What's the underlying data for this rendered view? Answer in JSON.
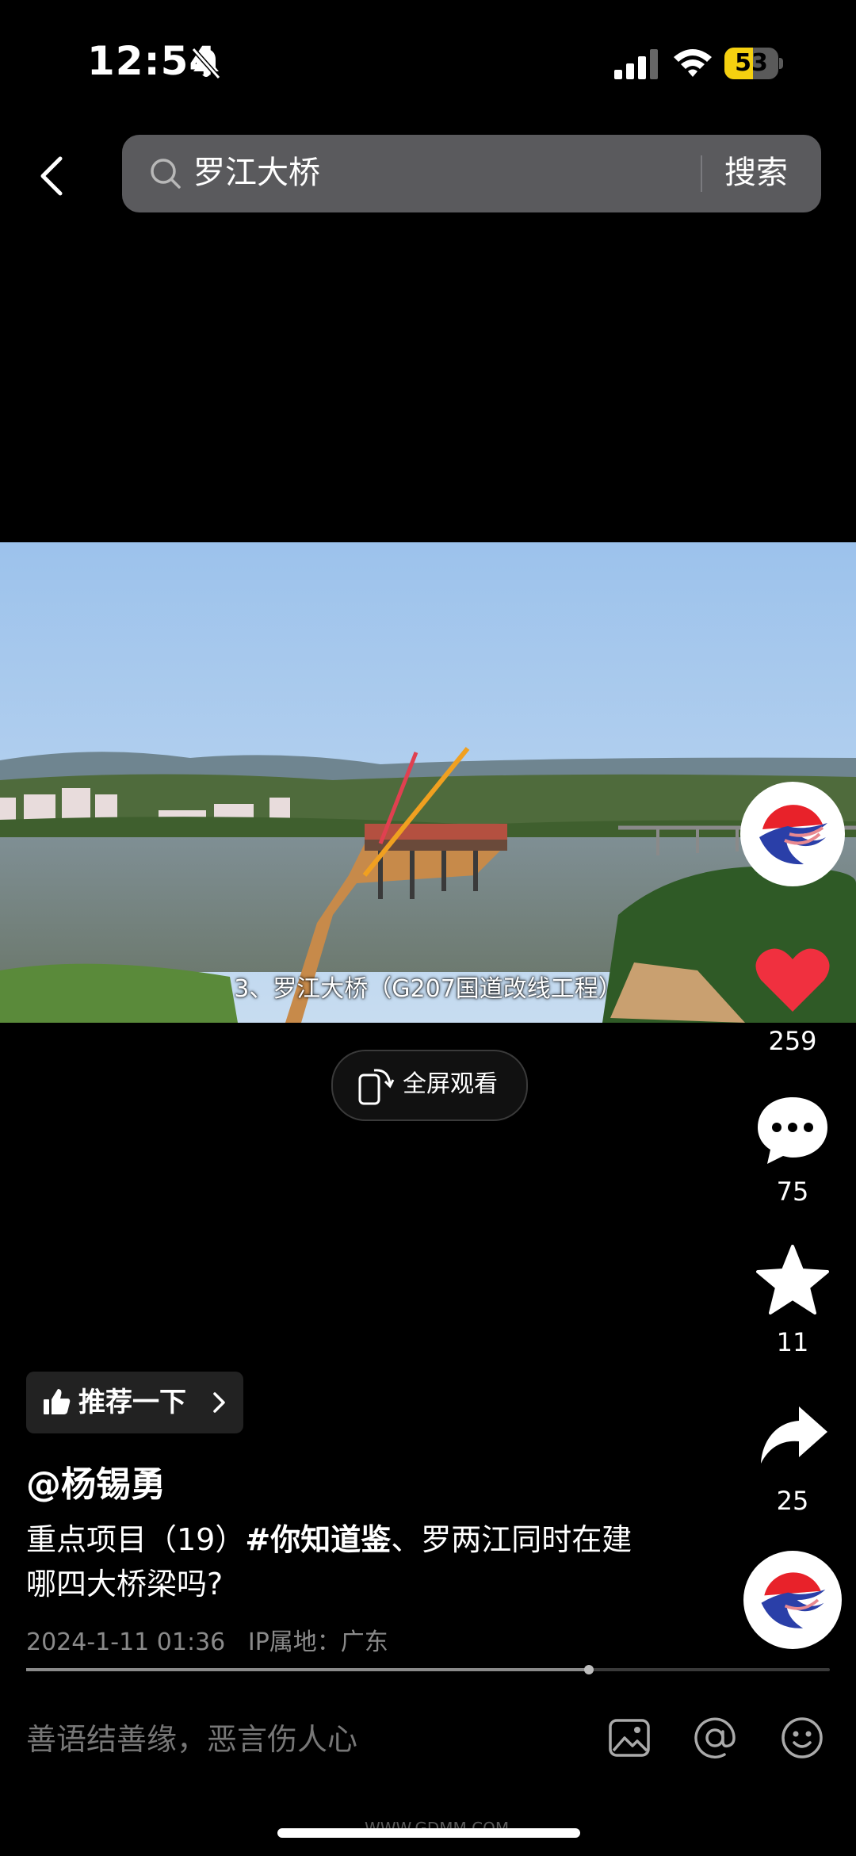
{
  "status_bar": {
    "time": "12:54",
    "battery_level": "53",
    "battery_fraction": 0.53
  },
  "search": {
    "query": "罗江大桥",
    "button": "搜索"
  },
  "video": {
    "caption": "3、罗江大桥（G207国道改线工程）"
  },
  "fullscreen_label": "全屏观看",
  "actions": {
    "likes": "259",
    "comments": "75",
    "favorites": "11",
    "shares": "25"
  },
  "colors": {
    "like": "#f0303f",
    "battery": "#f5d010",
    "search_bg": "#5a5a5d"
  },
  "post": {
    "recommend": "推荐一下",
    "author": "@杨锡勇",
    "desc_prefix": "重点项目（19）",
    "hashtag": "#你知道鉴",
    "desc_suffix": "、罗两江同时在建哪四大桥梁吗?",
    "date": "2024-1-11 01:36",
    "ip": "IP属地：广东"
  },
  "playback_progress": 0.7,
  "comment_input": {
    "placeholder": "善语结善缘，恶言伤人心"
  },
  "icons": [
    "bell-off-icon",
    "signal-icon",
    "wifi-icon",
    "battery-icon",
    "back-icon",
    "search-icon",
    "fullscreen-rotate-icon",
    "heart-icon",
    "comment-icon",
    "star-icon",
    "share-icon",
    "thumb-up-icon",
    "chevron-right-icon",
    "image-icon",
    "at-icon",
    "emoji-icon"
  ],
  "watermark": "WWW.GDMM.COM"
}
